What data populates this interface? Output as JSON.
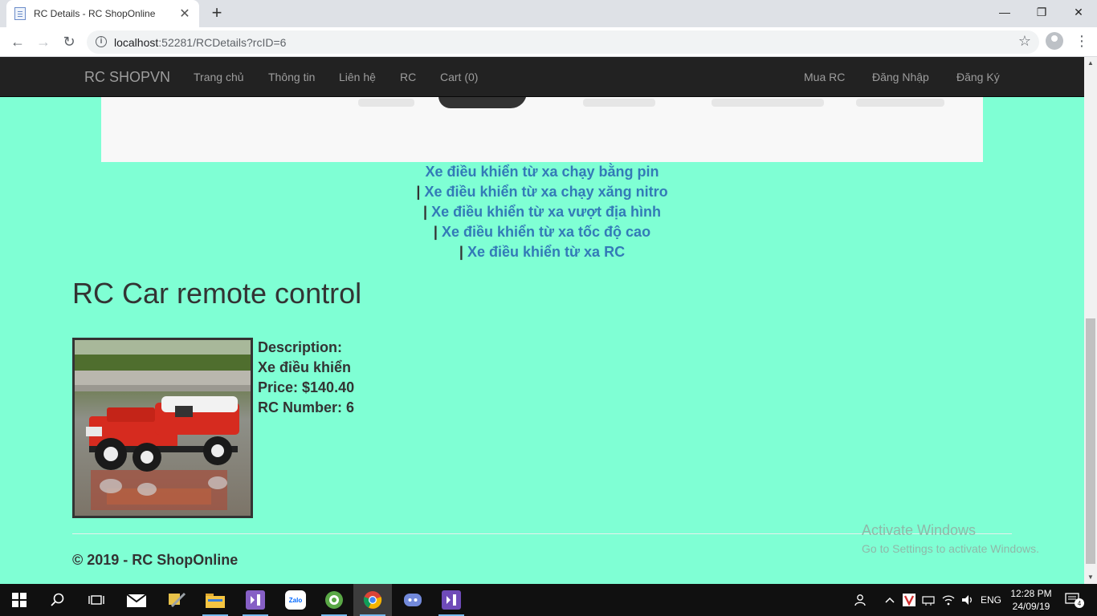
{
  "browser": {
    "tab_title": "RC Details - RC ShopOnline",
    "tab_close": "✕",
    "new_tab": "+",
    "url_host": "localhost",
    "url_rest": ":52281/RCDetails?rcID=6",
    "window_controls": {
      "minimize": "—",
      "maximize": "❐",
      "close": "✕"
    }
  },
  "navbar": {
    "brand": "RC SHOPVN",
    "links": [
      "Trang chủ",
      "Thông tin",
      "Liên hệ",
      "RC",
      "Cart (0)"
    ],
    "right_links": [
      "Mua RC",
      "Đăng Nhập",
      "Đăng Ký"
    ]
  },
  "categories": {
    "separator": "|",
    "items": [
      "Xe điều khiển từ xa chạy bằng pin",
      "Xe điều khiển từ xa chạy xăng nitro",
      "Xe điều khiển từ xa vượt địa hình",
      "Xe điều khiển từ xa tốc độ cao",
      "Xe điều khiển từ xa RC"
    ]
  },
  "product": {
    "title": "RC Car remote control",
    "description_label": "Description:",
    "description": "Xe điều khiển",
    "price": "Price: $140.40",
    "number": "RC Number: 6"
  },
  "footer": {
    "text": "© 2019 - RC ShopOnline"
  },
  "watermark": {
    "line1": "Activate Windows",
    "line2": "Go to Settings to activate Windows."
  },
  "taskbar": {
    "apps": [
      "start-icon",
      "search-icon",
      "task-view-icon",
      "mail-icon",
      "tools-icon",
      "file-explorer-icon",
      "visual-studio-icon",
      "zalo-icon",
      "coccoc-icon",
      "chrome-icon",
      "discord-icon",
      "visual-studio-2-icon"
    ],
    "zalo_label": "Zalo",
    "language": "ENG",
    "time": "12:28 PM",
    "date": "24/09/19",
    "notifications": "4"
  },
  "colors": {
    "page_bg": "#7fffd4",
    "navbar_bg": "#222222",
    "link": "#337ab7",
    "text": "#333333"
  }
}
